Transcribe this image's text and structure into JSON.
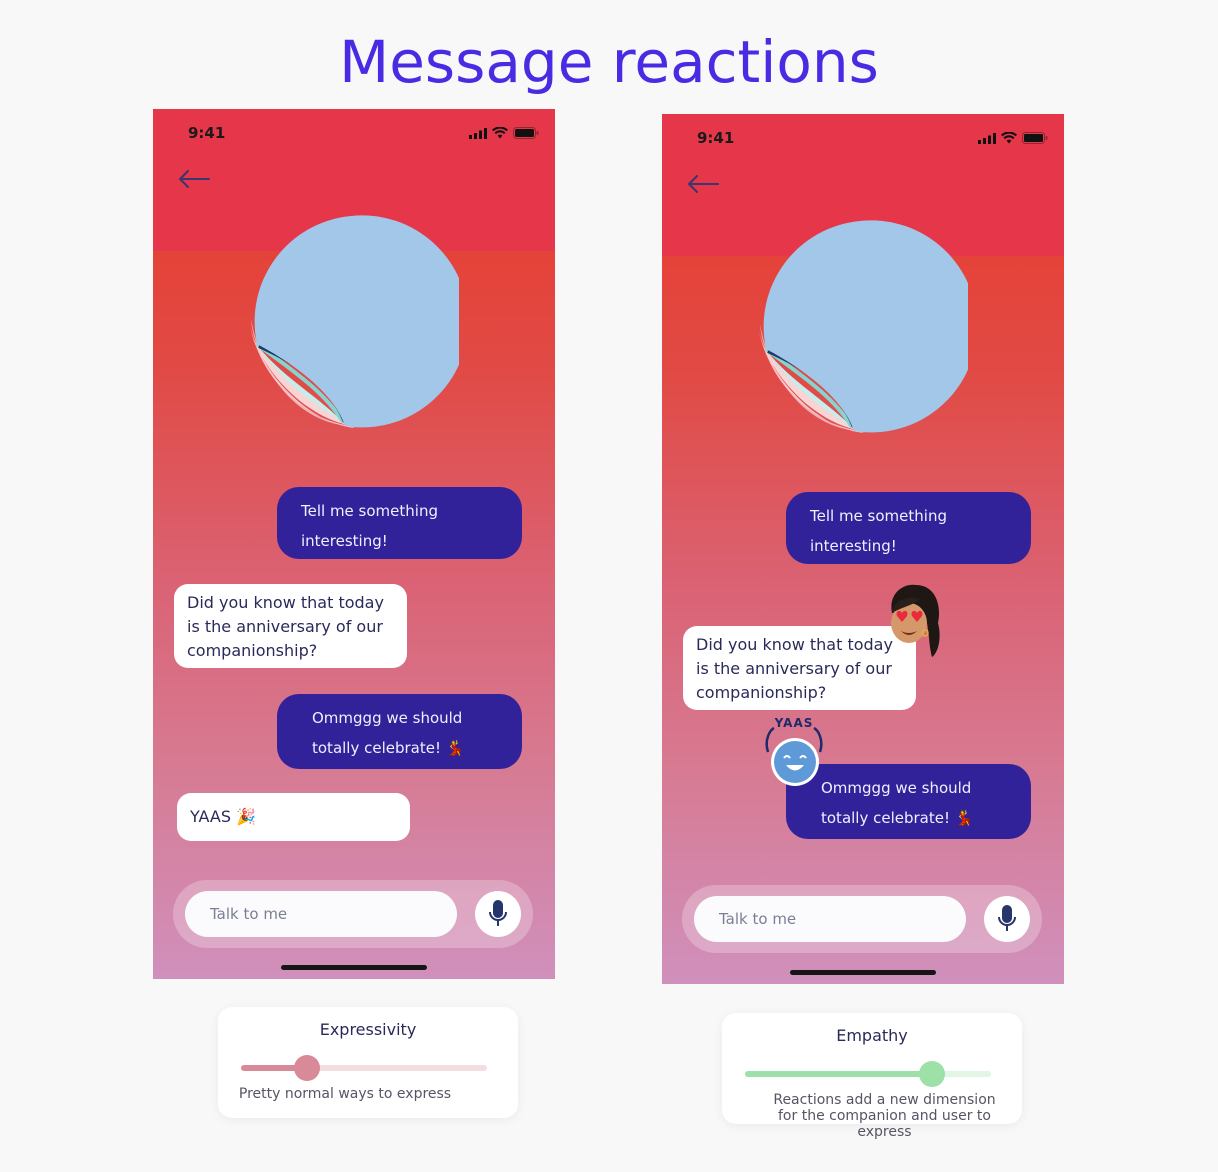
{
  "page": {
    "title": "Message reactions"
  },
  "colors": {
    "title": "#4a2be3",
    "user_bubble": "#31229a",
    "expressivity_accent": "#d88a98",
    "empathy_accent": "#9de0a8"
  },
  "phones": [
    {
      "status_time": "9:41",
      "messages": [
        {
          "from": "user",
          "text": "Tell me something interesting!"
        },
        {
          "from": "bot",
          "text": "Did you know that today is the anniversary of our companionship?"
        },
        {
          "from": "user",
          "text": "Ommggg we should totally celebrate! 💃"
        },
        {
          "from": "bot",
          "text": "YAAS 🎉"
        }
      ],
      "input_placeholder": "Talk to me"
    },
    {
      "status_time": "9:41",
      "messages": [
        {
          "from": "user",
          "text": "Tell me something interesting!"
        },
        {
          "from": "bot",
          "text": "Did you know that today is the anniversary of our companionship?",
          "reaction": "heart-eyes-memoji-icon"
        },
        {
          "from": "user",
          "text": "Ommggg we should totally celebrate! 💃",
          "reaction": "yaas-sticker-icon"
        }
      ],
      "reaction_sticker_text": "YAAS",
      "input_placeholder": "Talk to me"
    }
  ],
  "cards": [
    {
      "title": "Expressivity",
      "description": "Pretty normal ways to express",
      "level": 0.27
    },
    {
      "title": "Empathy",
      "description": "Reactions add a new dimension for the companion and user to express",
      "level": 0.76
    }
  ]
}
